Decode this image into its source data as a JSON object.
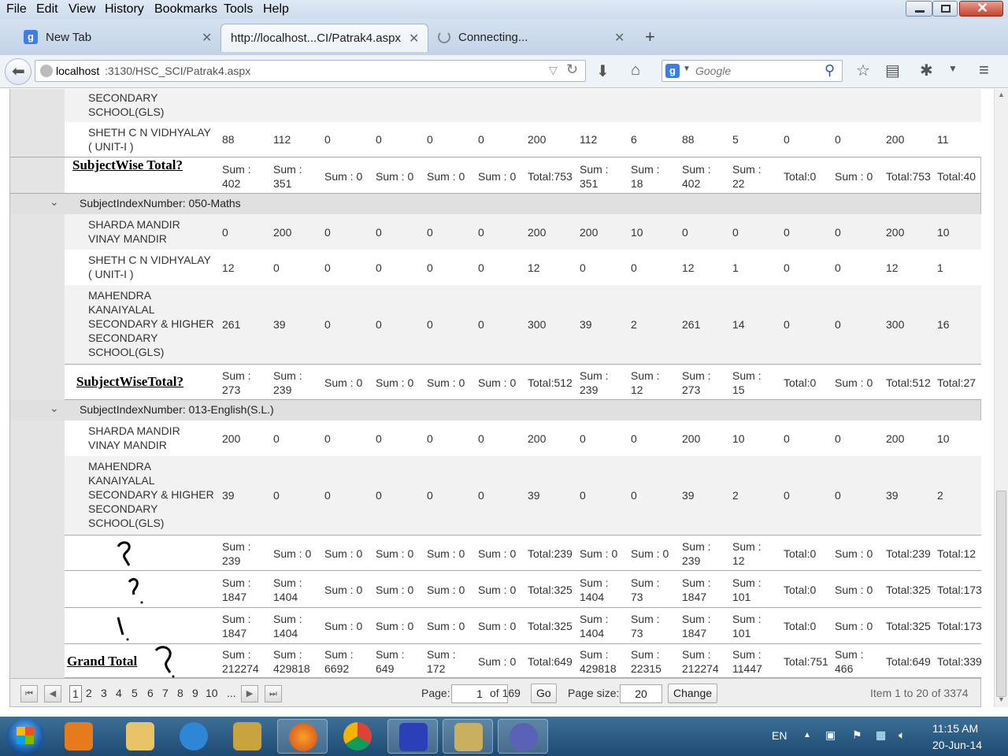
{
  "menu": [
    "File",
    "Edit",
    "View",
    "History",
    "Bookmarks",
    "Tools",
    "Help"
  ],
  "tabs": [
    {
      "title": "New Tab"
    },
    {
      "title": "http://localhost...CI/Patrak4.aspx"
    },
    {
      "title": "Connecting..."
    }
  ],
  "url": {
    "host": "localhost",
    "rest": ":3130/HSC_SCI/Patrak4.aspx"
  },
  "search": {
    "placeholder": "Google"
  },
  "grid": {
    "rows": [
      {
        "name": [
          "SECONDARY",
          "SCHOOL(GLS)"
        ],
        "values": []
      },
      {
        "name": [
          "SHETH C N VIDHYALAY",
          "( UNIT-I )"
        ],
        "values": [
          "88",
          "112",
          "0",
          "0",
          "0",
          "0",
          "200",
          "112",
          "6",
          "88",
          "5",
          "0",
          "0",
          "200",
          "11"
        ]
      }
    ],
    "sum1": {
      "title": "SubjectWise Total?",
      "values": [
        [
          "Sum :",
          "402"
        ],
        [
          "Sum :",
          "351"
        ],
        [
          "Sum : 0"
        ],
        [
          "Sum : 0"
        ],
        [
          "Sum : 0"
        ],
        [
          "Sum : 0"
        ],
        [
          "Total:753"
        ],
        [
          "Sum :",
          "351"
        ],
        [
          "Sum :",
          "18"
        ],
        [
          "Sum :",
          "402"
        ],
        [
          "Sum :",
          "22"
        ],
        [
          "Total:0"
        ],
        [
          "Sum : 0"
        ],
        [
          "Total:753"
        ],
        [
          "Total:40"
        ]
      ]
    },
    "group2": {
      "label": "SubjectIndexNumber: 050-Maths",
      "rows": [
        {
          "name": [
            "SHARDA MANDIR",
            "VINAY MANDIR"
          ],
          "values": [
            "0",
            "200",
            "0",
            "0",
            "0",
            "0",
            "200",
            "200",
            "10",
            "0",
            "0",
            "0",
            "0",
            "200",
            "10"
          ]
        },
        {
          "name": [
            "SHETH C N VIDHYALAY",
            "( UNIT-I )"
          ],
          "values": [
            "12",
            "0",
            "0",
            "0",
            "0",
            "0",
            "12",
            "0",
            "0",
            "12",
            "1",
            "0",
            "0",
            "12",
            "1"
          ]
        },
        {
          "name": [
            "MAHENDRA",
            "KANAIYALAL",
            "SECONDARY & HIGHER",
            "SECONDARY",
            "SCHOOL(GLS)"
          ],
          "values": [
            "261",
            "39",
            "0",
            "0",
            "0",
            "0",
            "300",
            "39",
            "2",
            "261",
            "14",
            "0",
            "0",
            "300",
            "16"
          ]
        }
      ]
    },
    "sum2": {
      "title": "SubjectWiseTotal?",
      "values": [
        [
          "Sum :",
          "273"
        ],
        [
          "Sum :",
          "239"
        ],
        [
          "Sum : 0"
        ],
        [
          "Sum : 0"
        ],
        [
          "Sum : 0"
        ],
        [
          "Sum : 0"
        ],
        [
          "Total:512"
        ],
        [
          "Sum :",
          "239"
        ],
        [
          "Sum :",
          "12"
        ],
        [
          "Sum :",
          "273"
        ],
        [
          "Sum :",
          "15"
        ],
        [
          "Total:0"
        ],
        [
          "Sum : 0"
        ],
        [
          "Total:512"
        ],
        [
          "Total:27"
        ]
      ]
    },
    "group3": {
      "label": "SubjectIndexNumber: 013-English(S.L.)",
      "rows": [
        {
          "name": [
            "SHARDA MANDIR",
            "VINAY MANDIR"
          ],
          "values": [
            "200",
            "0",
            "0",
            "0",
            "0",
            "0",
            "200",
            "0",
            "0",
            "200",
            "10",
            "0",
            "0",
            "200",
            "10"
          ]
        },
        {
          "name": [
            "MAHENDRA",
            "KANAIYALAL",
            "SECONDARY & HIGHER",
            "SECONDARY",
            "SCHOOL(GLS)"
          ],
          "values": [
            "39",
            "0",
            "0",
            "0",
            "0",
            "0",
            "39",
            "0",
            "0",
            "39",
            "2",
            "0",
            "0",
            "39",
            "2"
          ]
        }
      ]
    },
    "sum3": {
      "values": [
        [
          "Sum :",
          "239"
        ],
        [
          "Sum : 0"
        ],
        [
          "Sum : 0"
        ],
        [
          "Sum : 0"
        ],
        [
          "Sum : 0"
        ],
        [
          "Sum : 0"
        ],
        [
          "Total:239"
        ],
        [
          "Sum : 0"
        ],
        [
          "Sum : 0"
        ],
        [
          "Sum :",
          "239"
        ],
        [
          "Sum :",
          "12"
        ],
        [
          "Total:0"
        ],
        [
          "Sum : 0"
        ],
        [
          "Total:239"
        ],
        [
          "Total:12"
        ]
      ]
    },
    "sum4": {
      "values": [
        [
          "Sum :",
          "1847"
        ],
        [
          "Sum :",
          "1404"
        ],
        [
          "Sum : 0"
        ],
        [
          "Sum : 0"
        ],
        [
          "Sum : 0"
        ],
        [
          "Sum : 0"
        ],
        [
          "Total:325"
        ],
        [
          "Sum :",
          "1404"
        ],
        [
          "Sum :",
          "73"
        ],
        [
          "Sum :",
          "1847"
        ],
        [
          "Sum :",
          "101"
        ],
        [
          "Total:0"
        ],
        [
          "Sum : 0"
        ],
        [
          "Total:325"
        ],
        [
          "Total:173"
        ]
      ]
    },
    "sum5": {
      "values": [
        [
          "Sum :",
          "1847"
        ],
        [
          "Sum :",
          "1404"
        ],
        [
          "Sum : 0"
        ],
        [
          "Sum : 0"
        ],
        [
          "Sum : 0"
        ],
        [
          "Sum : 0"
        ],
        [
          "Total:325"
        ],
        [
          "Sum :",
          "1404"
        ],
        [
          "Sum :",
          "73"
        ],
        [
          "Sum :",
          "1847"
        ],
        [
          "Sum :",
          "101"
        ],
        [
          "Total:0"
        ],
        [
          "Sum : 0"
        ],
        [
          "Total:325"
        ],
        [
          "Total:173"
        ]
      ]
    },
    "grand": {
      "title": "Grand Total",
      "values": [
        [
          "Sum :",
          "212274"
        ],
        [
          "Sum :",
          "429818"
        ],
        [
          "Sum :",
          "6692"
        ],
        [
          "Sum :",
          "649"
        ],
        [
          "Sum :",
          "172"
        ],
        [
          "Sum : 0"
        ],
        [
          "Total:649"
        ],
        [
          "Sum :",
          "429818"
        ],
        [
          "Sum :",
          "22315"
        ],
        [
          "Sum :",
          "212274"
        ],
        [
          "Sum :",
          "11447"
        ],
        [
          "Total:751"
        ],
        [
          "Sum :",
          "466"
        ],
        [
          "Total:649"
        ],
        [
          "Total:339"
        ]
      ]
    }
  },
  "pager": {
    "pages": [
      "1",
      "2",
      "3",
      "4",
      "5",
      "6",
      "7",
      "8",
      "9",
      "10",
      "..."
    ],
    "page_label": "Page:",
    "page_value": "1",
    "of_label": "of 169",
    "go": "Go",
    "size_label": "Page size:",
    "size_value": "20",
    "change": "Change",
    "info": "Item 1 to 20 of 3374"
  },
  "tray": {
    "lang": "EN",
    "time": "11:15 AM",
    "date": "20-Jun-14"
  }
}
